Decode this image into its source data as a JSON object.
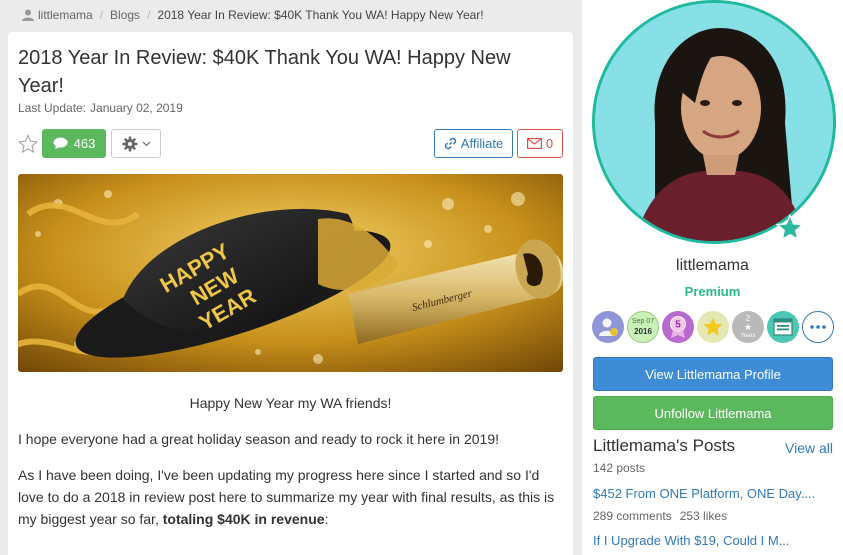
{
  "breadcrumb": {
    "user": "littlemama",
    "section": "Blogs",
    "current": "2018 Year In Review: $40K Thank You WA! Happy New Year!"
  },
  "article": {
    "title": "2018 Year In Review: $40K Thank You WA! Happy New Year!",
    "last_update_label": "Last Update:",
    "last_update_date": "January 02, 2019",
    "comment_count": "463",
    "affiliate_label": "Affiliate",
    "mail_count": "0",
    "hero_image": {
      "hat_lines": [
        "HAPPY",
        "NEW",
        "YEAR"
      ],
      "bottle_label": "Schlumberger"
    },
    "paragraphs": [
      "Happy New Year my WA friends!",
      "I hope everyone had a great holiday season and ready to rock it here in 2019!",
      "As I have been doing, I've been updating my progress here since I started and so I'd love to do a 2018 in review post here to summarize my year with final results, as this is my biggest year so far,"
    ],
    "emphasis": "totaling $40K in revenue",
    "emphasis_suffix": ":"
  },
  "sidebar": {
    "username": "littlemama",
    "rank": "Premium",
    "badges": {
      "date_month": "Sep 07",
      "date_year": "2016",
      "level_number": "5",
      "years_number": "2",
      "years_label": "Years"
    },
    "profile_button": "View Littlemama Profile",
    "unfollow_button": "Unfollow Littlemama",
    "posts_title": "Littlemama's Posts",
    "view_all": "View all",
    "posts_count": "142 posts",
    "posts": [
      {
        "title": "$452 From ONE Platform, ONE Day....",
        "comments": "289 comments",
        "likes": "253 likes"
      },
      {
        "title": "If I Upgrade With $19, Could I M..."
      }
    ]
  },
  "colors": {
    "accent_blue": "#337ab7",
    "success_green": "#5cb85c",
    "premium_green": "#2eb886",
    "danger_red": "#d9534f"
  }
}
